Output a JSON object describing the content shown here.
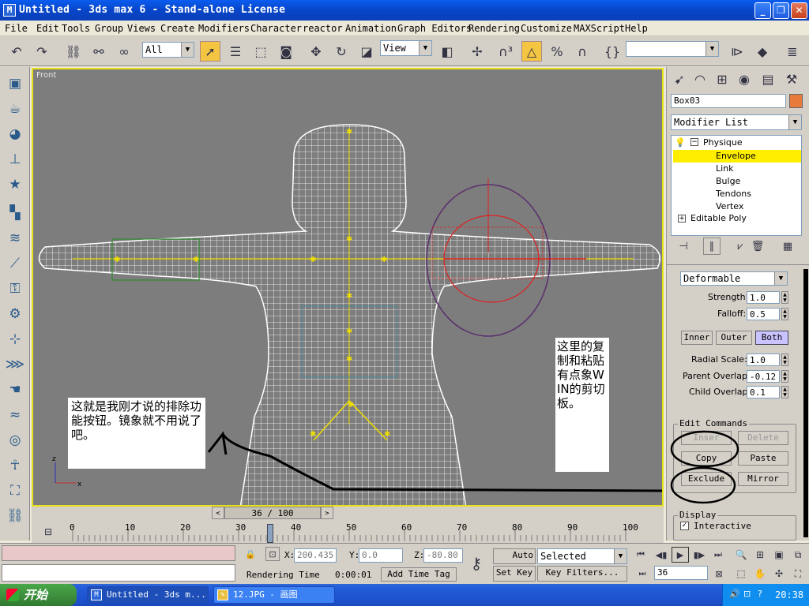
{
  "window": {
    "title": "Untitled - 3ds max 6 - Stand-alone License",
    "icon": "max-app-icon",
    "controls": [
      "_",
      "❐",
      "✕"
    ]
  },
  "menu": [
    "File",
    "Edit",
    "Tools",
    "Group",
    "Views",
    "Create",
    "Modifiers",
    "Character",
    "reactor",
    "Animation",
    "Graph Editors",
    "Rendering",
    "Customize",
    "MAXScript",
    "Help"
  ],
  "toolbar": {
    "selection_filter": "All",
    "reference_coord": "View",
    "named_selection": ""
  },
  "viewport": {
    "label": "Front"
  },
  "command_panel": {
    "object_name": "Box03",
    "object_color": "#e87a3c",
    "modifier_list_label": "Modifier List",
    "stack": {
      "physique": "Physique",
      "subobjects": [
        "Envelope",
        "Link",
        "Bulge",
        "Tendons",
        "Vertex"
      ],
      "selected_subobject": "Envelope",
      "editable_poly": "Editable Poly"
    },
    "envelope": {
      "type": "Deformable",
      "strength_label": "Strength:",
      "strength": "1.0",
      "falloff_label": "Falloff:",
      "falloff": "0.5",
      "inner": "Inner",
      "outer": "Outer",
      "both": "Both",
      "radial_scale_label": "Radial Scale:",
      "radial_scale": "1.0",
      "parent_overlap_label": "Parent Overlap:",
      "parent_overlap": "-0.12",
      "child_overlap_label": "Child Overlap:",
      "child_overlap": "0.1"
    },
    "edit_commands": {
      "title": "Edit Commands",
      "insert": "Inser",
      "delete": "Delete",
      "copy": "Copy",
      "paste": "Paste",
      "exclude": "Exclude",
      "mirror": "Mirror"
    },
    "display": {
      "title": "Display",
      "interactive": "Interactive",
      "interactive_checked": true
    }
  },
  "timeline": {
    "slider": "36 / 100",
    "current": 36,
    "total": 100,
    "ticks": [
      "0",
      "10",
      "20",
      "30",
      "40",
      "50",
      "60",
      "70",
      "80",
      "90",
      "100"
    ]
  },
  "status": {
    "x_label": "X:",
    "x": "200.435",
    "y_label": "Y:",
    "y": "0.0",
    "z_label": "Z:",
    "z": "-80.80",
    "rendering_time_label": "Rendering Time",
    "rendering_time": "0:00:01",
    "add_time_tag": "Add Time Tag",
    "auto_key": "Auto Key",
    "set_key": "Set Key",
    "key_mode": "Selected",
    "key_filters": "Key Filters...",
    "frame": "36"
  },
  "annotations": {
    "left_note": "这就是我刚才说的排除功能按钮。镜象就不用说了吧。",
    "right_note": "这里的复制和粘贴有点象WIN的剪切板。"
  },
  "taskbar": {
    "start": "开始",
    "tasks": [
      "Untitled - 3ds m...",
      "12.JPG - 画图"
    ],
    "clock": "20:38"
  }
}
